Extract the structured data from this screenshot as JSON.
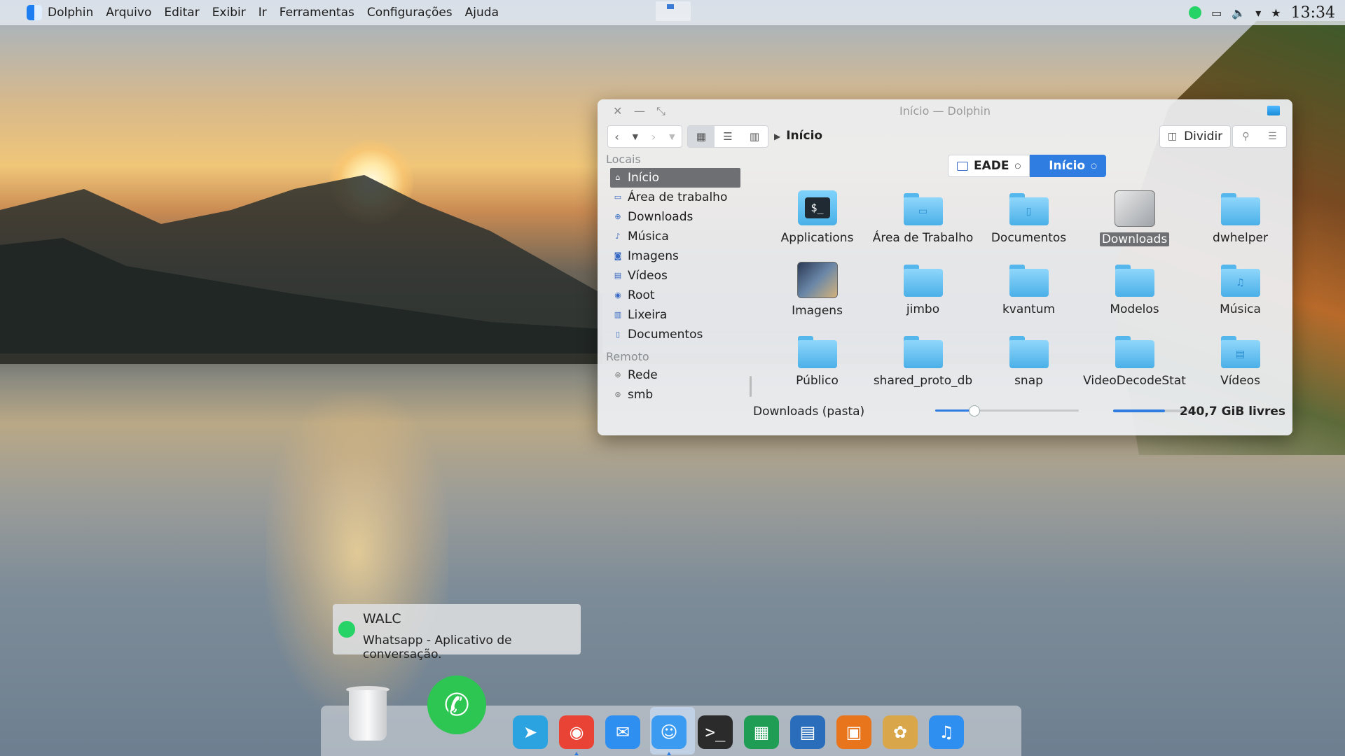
{
  "menubar": {
    "app_name": "Dolphin",
    "menus": [
      "Arquivo",
      "Editar",
      "Exibir",
      "Ir",
      "Ferramentas",
      "Configurações",
      "Ajuda"
    ],
    "clock": "13:34"
  },
  "window": {
    "title": "Início — Dolphin",
    "breadcrumb": "Início",
    "split_label": "Dividir",
    "tabs": [
      {
        "label": "EADE",
        "active": false
      },
      {
        "label": "Início",
        "active": true
      }
    ]
  },
  "sidebar": {
    "sections": [
      {
        "title": "Locais",
        "items": [
          {
            "label": "Início",
            "icon": "home-icon",
            "selected": true
          },
          {
            "label": "Área de trabalho",
            "icon": "desktop-icon",
            "selected": false
          },
          {
            "label": "Downloads",
            "icon": "download-icon",
            "selected": false
          },
          {
            "label": "Música",
            "icon": "music-icon",
            "selected": false
          },
          {
            "label": "Imagens",
            "icon": "image-icon",
            "selected": false
          },
          {
            "label": "Vídeos",
            "icon": "video-icon",
            "selected": false
          },
          {
            "label": "Root",
            "icon": "root-icon",
            "selected": false
          },
          {
            "label": "Lixeira",
            "icon": "trash-icon",
            "selected": false
          },
          {
            "label": "Documentos",
            "icon": "document-icon",
            "selected": false
          }
        ]
      },
      {
        "title": "Remoto",
        "items": [
          {
            "label": "Rede",
            "icon": "network-icon",
            "selected": false
          },
          {
            "label": "smb",
            "icon": "network-icon",
            "selected": false
          }
        ]
      }
    ]
  },
  "files": [
    {
      "name": "Applications",
      "kind": "terminal"
    },
    {
      "name": "Área de Trabalho",
      "kind": "folder",
      "emblem": "desktop"
    },
    {
      "name": "Documentos",
      "kind": "folder",
      "emblem": "document"
    },
    {
      "name": "Downloads",
      "kind": "thumbnail-downloads",
      "selected": true
    },
    {
      "name": "dwhelper",
      "kind": "folder"
    },
    {
      "name": "Imagens",
      "kind": "thumbnail-images"
    },
    {
      "name": "jimbo",
      "kind": "folder"
    },
    {
      "name": "kvantum",
      "kind": "folder"
    },
    {
      "name": "Modelos",
      "kind": "folder"
    },
    {
      "name": "Música",
      "kind": "folder",
      "emblem": "music"
    },
    {
      "name": "Público",
      "kind": "folder"
    },
    {
      "name": "shared_proto_db",
      "kind": "folder"
    },
    {
      "name": "snap",
      "kind": "folder"
    },
    {
      "name": "VideoDecodeStat",
      "kind": "folder"
    },
    {
      "name": "Vídeos",
      "kind": "folder",
      "emblem": "video"
    }
  ],
  "statusbar": {
    "selection_text": "Downloads (pasta)",
    "zoom_level": 0.27,
    "space_used_fraction": 0.66,
    "free_space": "240,7 GiB livres"
  },
  "notification": {
    "title": "WALC",
    "body": "Whatsapp - Aplicativo de conversação."
  },
  "dock": {
    "apps": [
      {
        "name": "telegram-icon",
        "color": "#2aa3e0"
      },
      {
        "name": "chrome-icon",
        "color": "#e94335"
      },
      {
        "name": "mail-icon",
        "color": "#2f8ff0"
      },
      {
        "name": "finder-icon",
        "color": "#3a9bf0",
        "running": true
      },
      {
        "name": "terminal-icon",
        "color": "#2b2b2b"
      },
      {
        "name": "spreadsheet-icon",
        "color": "#1f9d55"
      },
      {
        "name": "writer-icon",
        "color": "#2a6ebb"
      },
      {
        "name": "presentation-icon",
        "color": "#e8741c"
      },
      {
        "name": "photos-icon",
        "color": "#d9a64a"
      },
      {
        "name": "music-app-icon",
        "color": "#2f8ff0"
      },
      {
        "name": "apple-icon",
        "color": "#d7d9dc"
      }
    ]
  }
}
